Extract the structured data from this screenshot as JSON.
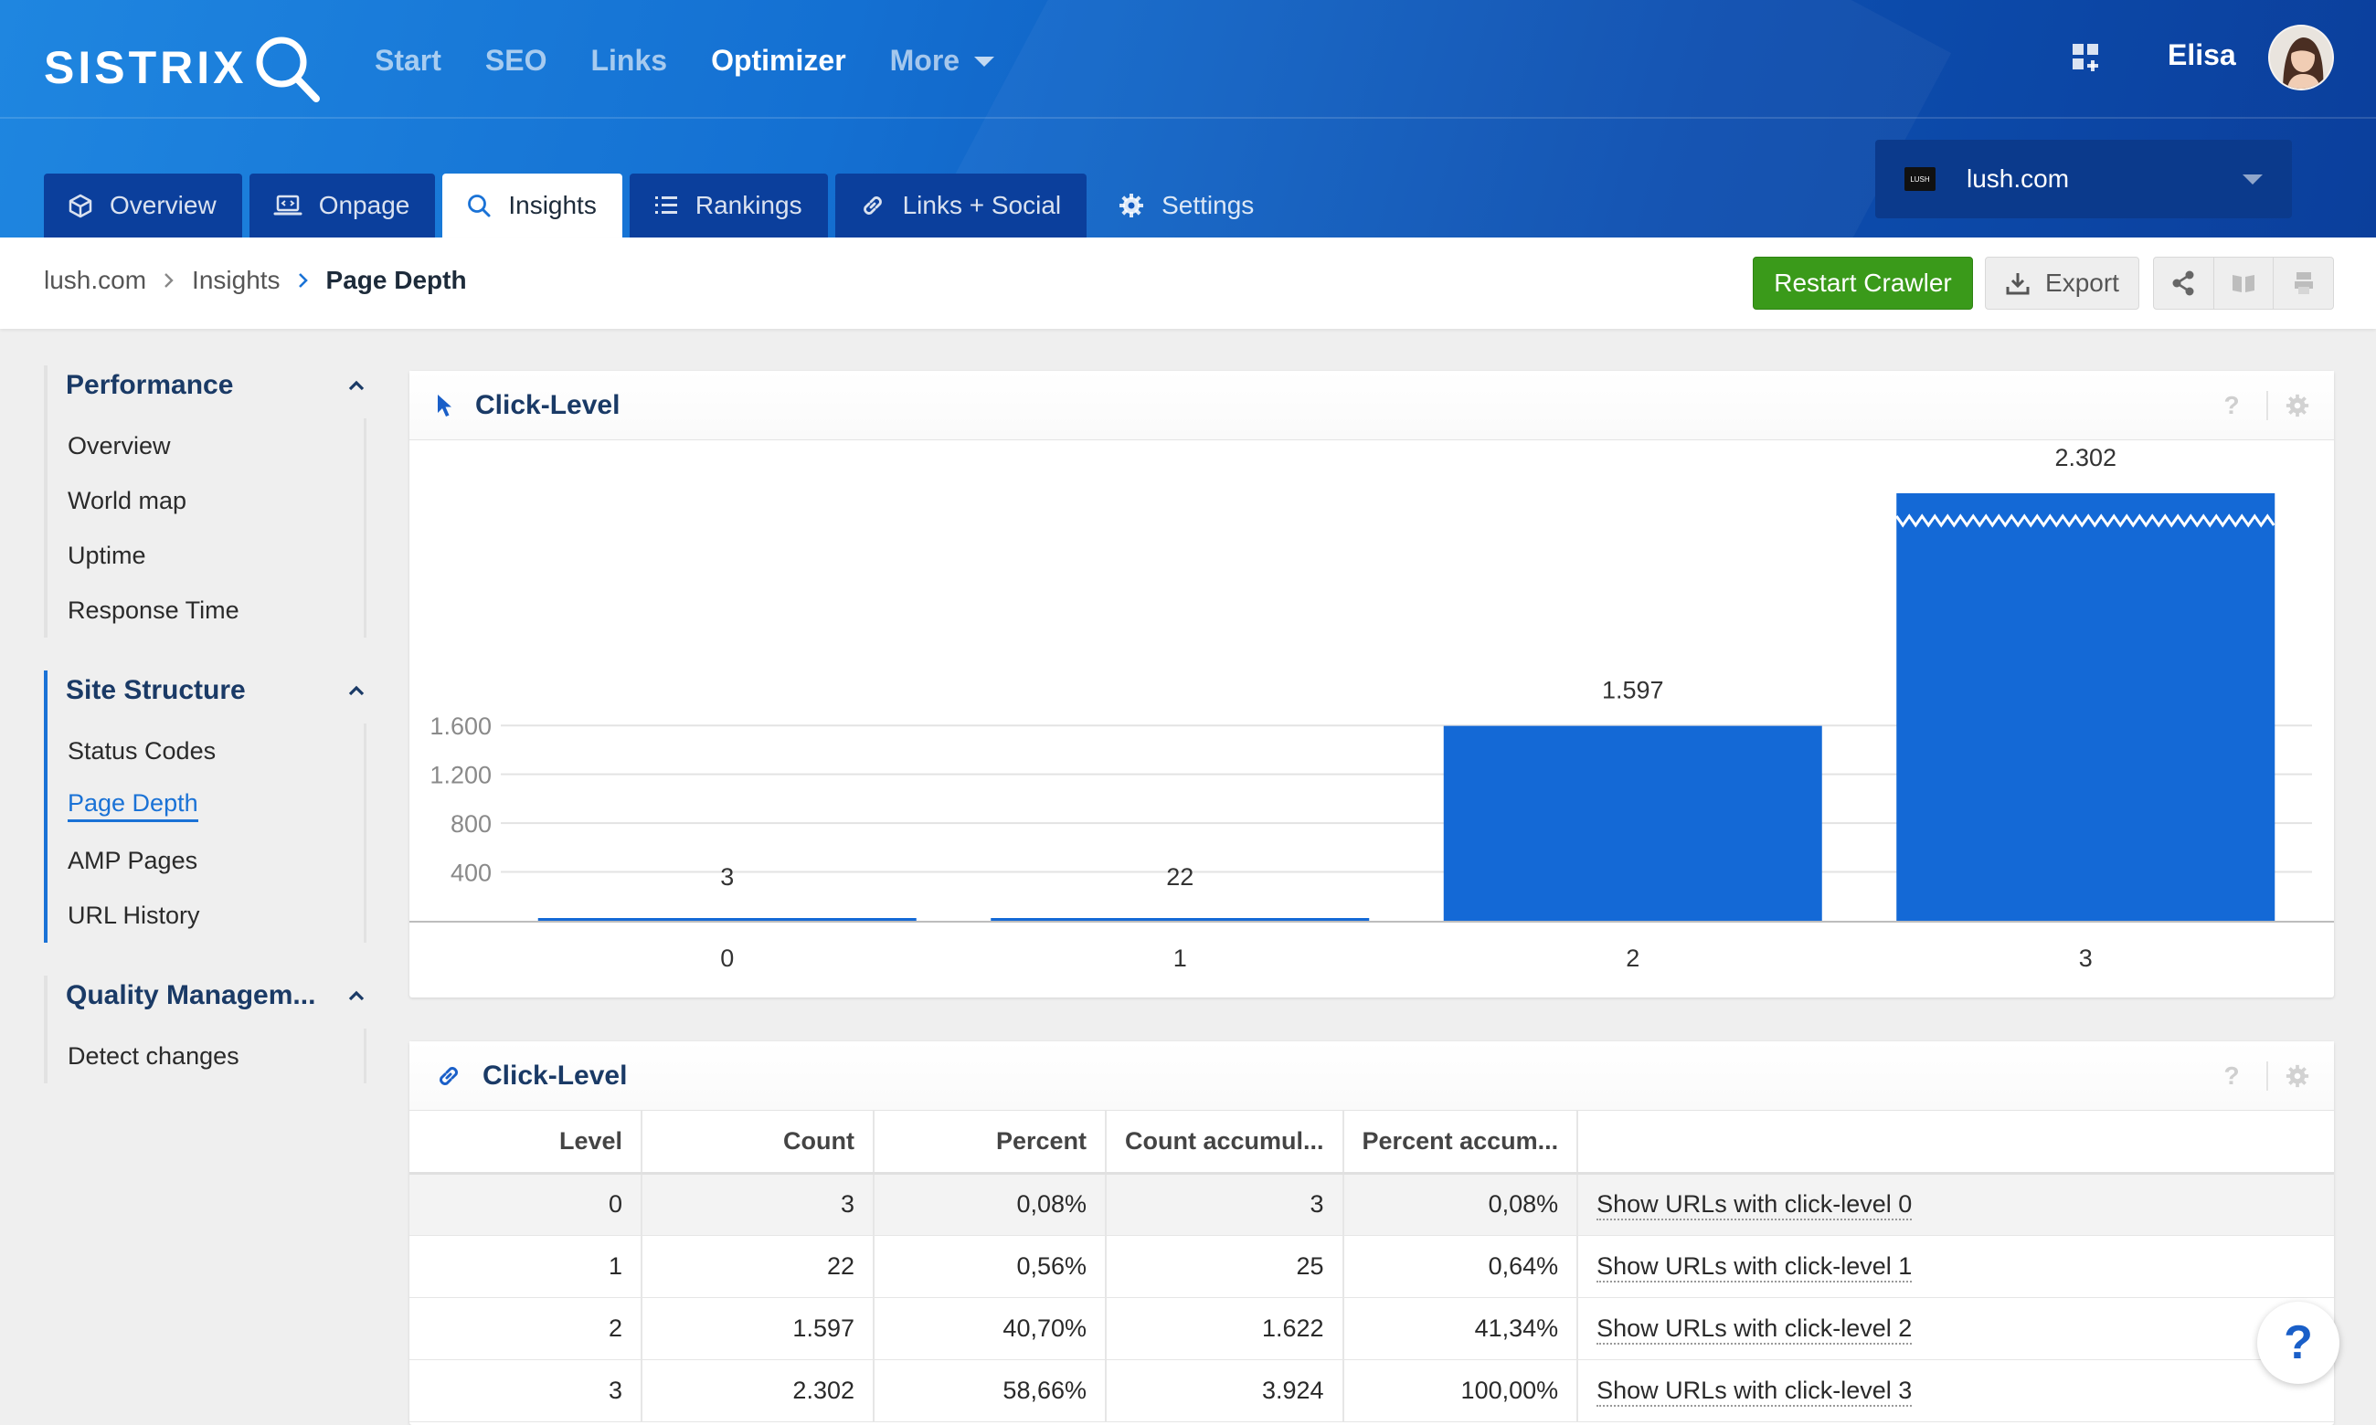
{
  "brand": {
    "name": "SISTRIX",
    "accent": "#1a72d6",
    "green": "#3a9a1a"
  },
  "nav": {
    "items": [
      {
        "label": "Start",
        "active": false
      },
      {
        "label": "SEO",
        "active": false
      },
      {
        "label": "Links",
        "active": false
      },
      {
        "label": "Optimizer",
        "active": true
      },
      {
        "label": "More",
        "active": false
      }
    ],
    "apps_icon": "apps-grid-icon",
    "user_name": "Elisa"
  },
  "tabs": [
    {
      "label": "Overview",
      "icon": "cube-icon"
    },
    {
      "label": "Onpage",
      "icon": "laptop-code-icon"
    },
    {
      "label": "Insights",
      "icon": "search-icon"
    },
    {
      "label": "Rankings",
      "icon": "list-icon"
    },
    {
      "label": "Links + Social",
      "icon": "link-icon"
    },
    {
      "label": "Settings",
      "icon": "gear-icon"
    }
  ],
  "project": {
    "domain": "lush.com",
    "favicon_text": "LUSH"
  },
  "breadcrumb": [
    "lush.com",
    "Insights",
    "Page Depth"
  ],
  "actions": {
    "restart": "Restart Crawler",
    "export": "Export"
  },
  "sidebar": [
    {
      "title": "Performance",
      "active": false,
      "items": [
        "Overview",
        "World map",
        "Uptime",
        "Response Time"
      ]
    },
    {
      "title": "Site Structure",
      "active": true,
      "items": [
        "Status Codes",
        "Page Depth",
        "AMP Pages",
        "URL History"
      ],
      "active_item": "Page Depth"
    },
    {
      "title": "Quality Managem...",
      "active": false,
      "items": [
        "Detect changes"
      ]
    }
  ],
  "chart_panel": {
    "title": "Click-Level",
    "help": "?"
  },
  "chart_data": {
    "type": "bar",
    "categories": [
      "0",
      "1",
      "2",
      "3"
    ],
    "values": [
      3,
      22,
      1597,
      2302
    ],
    "value_labels": [
      "3",
      "22",
      "1.597",
      "2.302"
    ],
    "ytick_labels": [
      "400",
      "800",
      "1.200",
      "1.600"
    ],
    "ytick_values": [
      400,
      800,
      1200,
      1600
    ],
    "ylim": [
      0,
      1600
    ],
    "broken_axis_series_index": 3,
    "bar_color": "#1469d6",
    "grid": true
  },
  "table_panel": {
    "title": "Click-Level",
    "help": "?",
    "columns": [
      "Level",
      "Count",
      "Percent",
      "Count accumul...",
      "Percent accum...",
      ""
    ],
    "rows": [
      {
        "level": "0",
        "count": "3",
        "percent": "0,08%",
        "count_acc": "3",
        "percent_acc": "0,08%",
        "link": "Show URLs with click-level 0"
      },
      {
        "level": "1",
        "count": "22",
        "percent": "0,56%",
        "count_acc": "25",
        "percent_acc": "0,64%",
        "link": "Show URLs with click-level 1"
      },
      {
        "level": "2",
        "count": "1.597",
        "percent": "40,70%",
        "count_acc": "1.622",
        "percent_acc": "41,34%",
        "link": "Show URLs with click-level 2"
      },
      {
        "level": "3",
        "count": "2.302",
        "percent": "58,66%",
        "count_acc": "3.924",
        "percent_acc": "100,00%",
        "link": "Show URLs with click-level 3"
      }
    ]
  },
  "help_fab": "?"
}
